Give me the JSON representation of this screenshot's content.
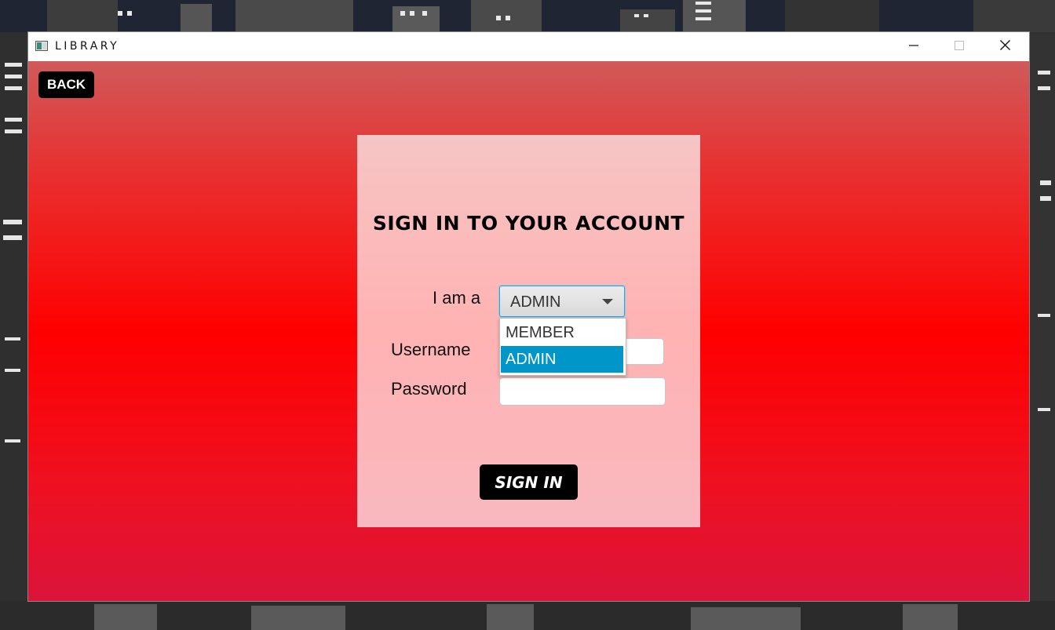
{
  "window": {
    "title": "LIBRARY"
  },
  "back_button": {
    "label": "BACK"
  },
  "form": {
    "title": "SIGN IN TO YOUR ACCOUNT",
    "role_label": "I am a",
    "role_selected": "ADMIN",
    "role_options": [
      "MEMBER",
      "ADMIN"
    ],
    "username_label": "Username",
    "username_value": "",
    "password_label": "Password",
    "password_value": "",
    "submit_label": "SIGN IN"
  },
  "icons": {
    "app": "window-app-icon",
    "minimize": "minimize-icon",
    "maximize": "maximize-icon",
    "close": "close-icon",
    "dropdown": "chevron-down-icon"
  },
  "colors": {
    "accent": "#0096c9",
    "gradient_top": "#d05a5a",
    "gradient_mid": "#ff0000",
    "gradient_bottom": "#db143a",
    "button_bg": "#000000",
    "button_text": "#ffffff"
  }
}
